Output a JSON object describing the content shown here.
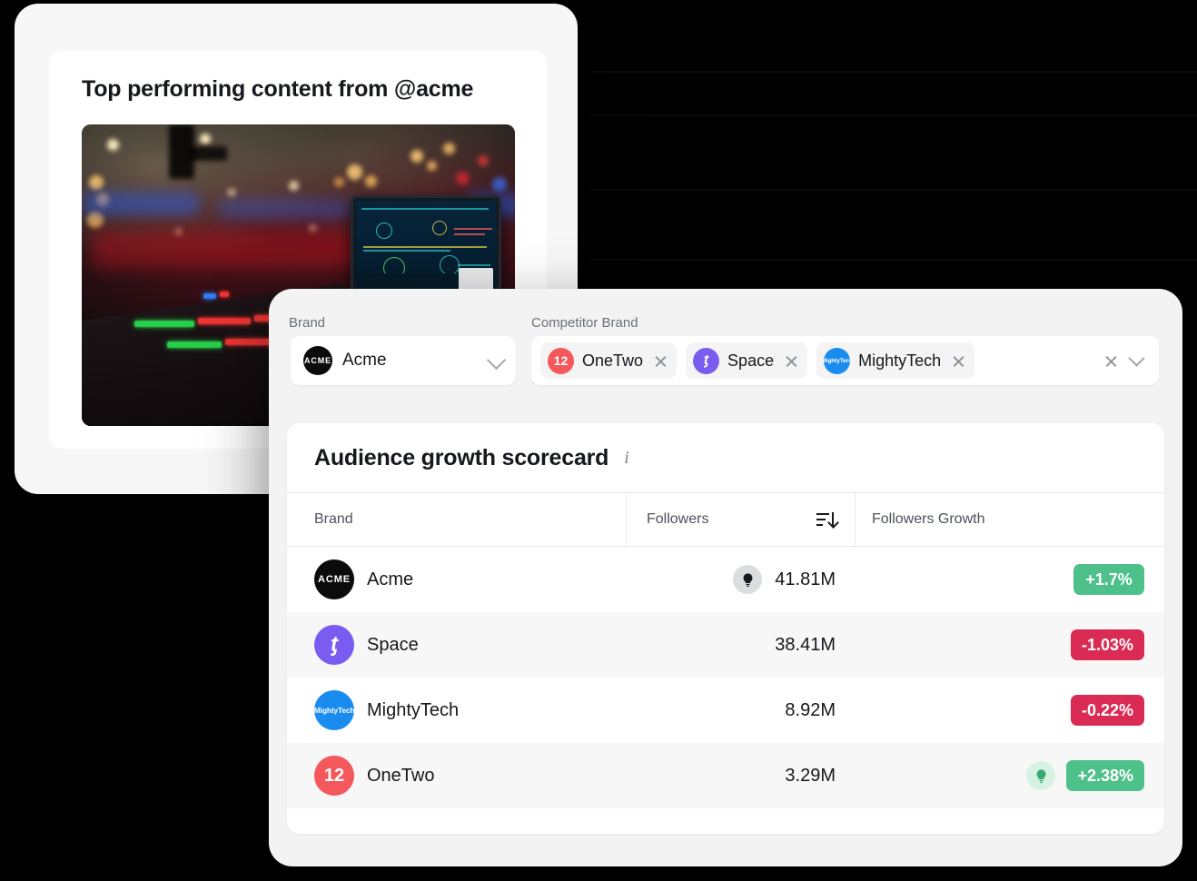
{
  "top_card": {
    "title": "Top performing content from @acme",
    "image_alt": "dj-booth-night-photo"
  },
  "filters": {
    "brand_label": "Brand",
    "competitor_label": "Competitor Brand",
    "brand_value": "Acme",
    "brand_avatar_text": "ACME",
    "competitor_chips": [
      {
        "name": "OneTwo",
        "avatar_text": "12",
        "avatar_color": "#f4585c",
        "remove_label": "×"
      },
      {
        "name": "Space",
        "avatar_text": "ƫ",
        "avatar_color": "#7b5cf0",
        "remove_label": "×"
      },
      {
        "name": "MightyTech",
        "avatar_text": "MightyTech",
        "avatar_color": "#1a8cf0",
        "remove_label": "×"
      }
    ],
    "clear_all_label": "×"
  },
  "scorecard": {
    "title": "Audience growth scorecard",
    "info_label": "i",
    "columns": [
      "Brand",
      "Followers",
      "Followers Growth"
    ],
    "sort_column": "Followers",
    "rows": [
      {
        "brand": "Acme",
        "avatar_text": "ACME",
        "avatar_color": "#0b0b0c",
        "followers": "41.81M",
        "growth": "+1.7%",
        "growth_direction": "up",
        "insight_bulb": "grey"
      },
      {
        "brand": "Space",
        "avatar_text": "ƫ",
        "avatar_color": "#7b5cf0",
        "followers": "38.41M",
        "growth": "-1.03%",
        "growth_direction": "down",
        "insight_bulb": "none"
      },
      {
        "brand": "MightyTech",
        "avatar_text": "MightyTech",
        "avatar_color": "#1a8cf0",
        "followers": "8.92M",
        "growth": "-0.22%",
        "growth_direction": "down",
        "insight_bulb": "none"
      },
      {
        "brand": "OneTwo",
        "avatar_text": "12",
        "avatar_color": "#f4585c",
        "followers": "3.29M",
        "growth": "+2.38%",
        "growth_direction": "up",
        "insight_bulb": "green"
      }
    ]
  },
  "colors": {
    "growth_up": "#4ec08a",
    "growth_down": "#d92b54",
    "panel_bg": "#f3f3f4",
    "card_bg": "#ffffff",
    "row_alt_bg": "#f7f7f8",
    "backdrop": "#000000"
  }
}
